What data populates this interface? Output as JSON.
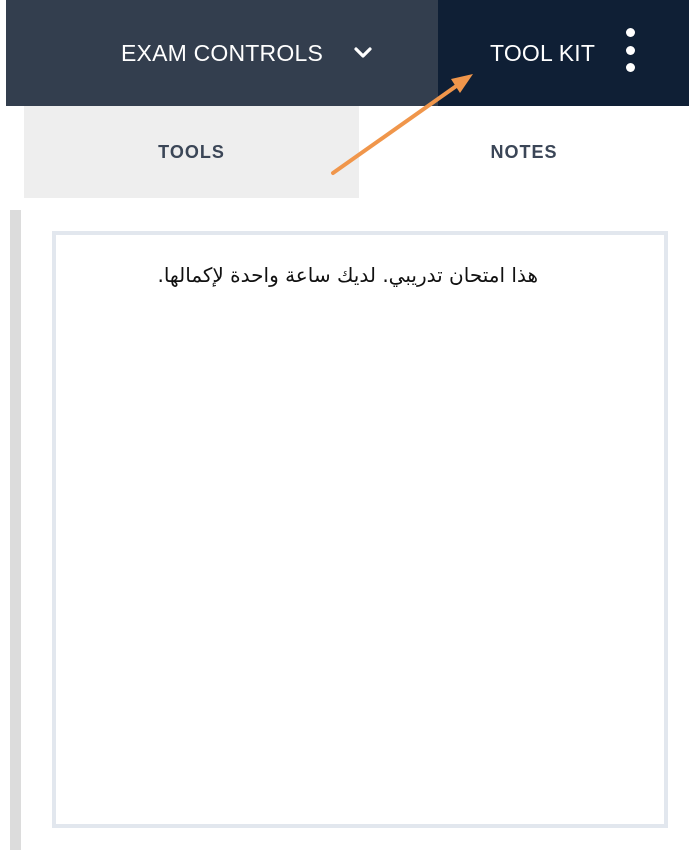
{
  "header": {
    "exam_controls_label": "EXAM CONTROLS",
    "exam_controls_icon": "chevron-down-icon",
    "tool_kit_label": "TOOL KIT",
    "tool_kit_menu_icon": "kebab-menu-icon"
  },
  "tabs": [
    {
      "label": "TOOLS"
    },
    {
      "label": "NOTES"
    }
  ],
  "notes": {
    "text": "هذا امتحان تدريبي. لديك ساعة واحدة لإكمالها."
  },
  "colors": {
    "exam_controls_bg": "#333e4e",
    "tool_kit_bg": "#0f1f35",
    "annotation_arrow": "#f0964b"
  }
}
